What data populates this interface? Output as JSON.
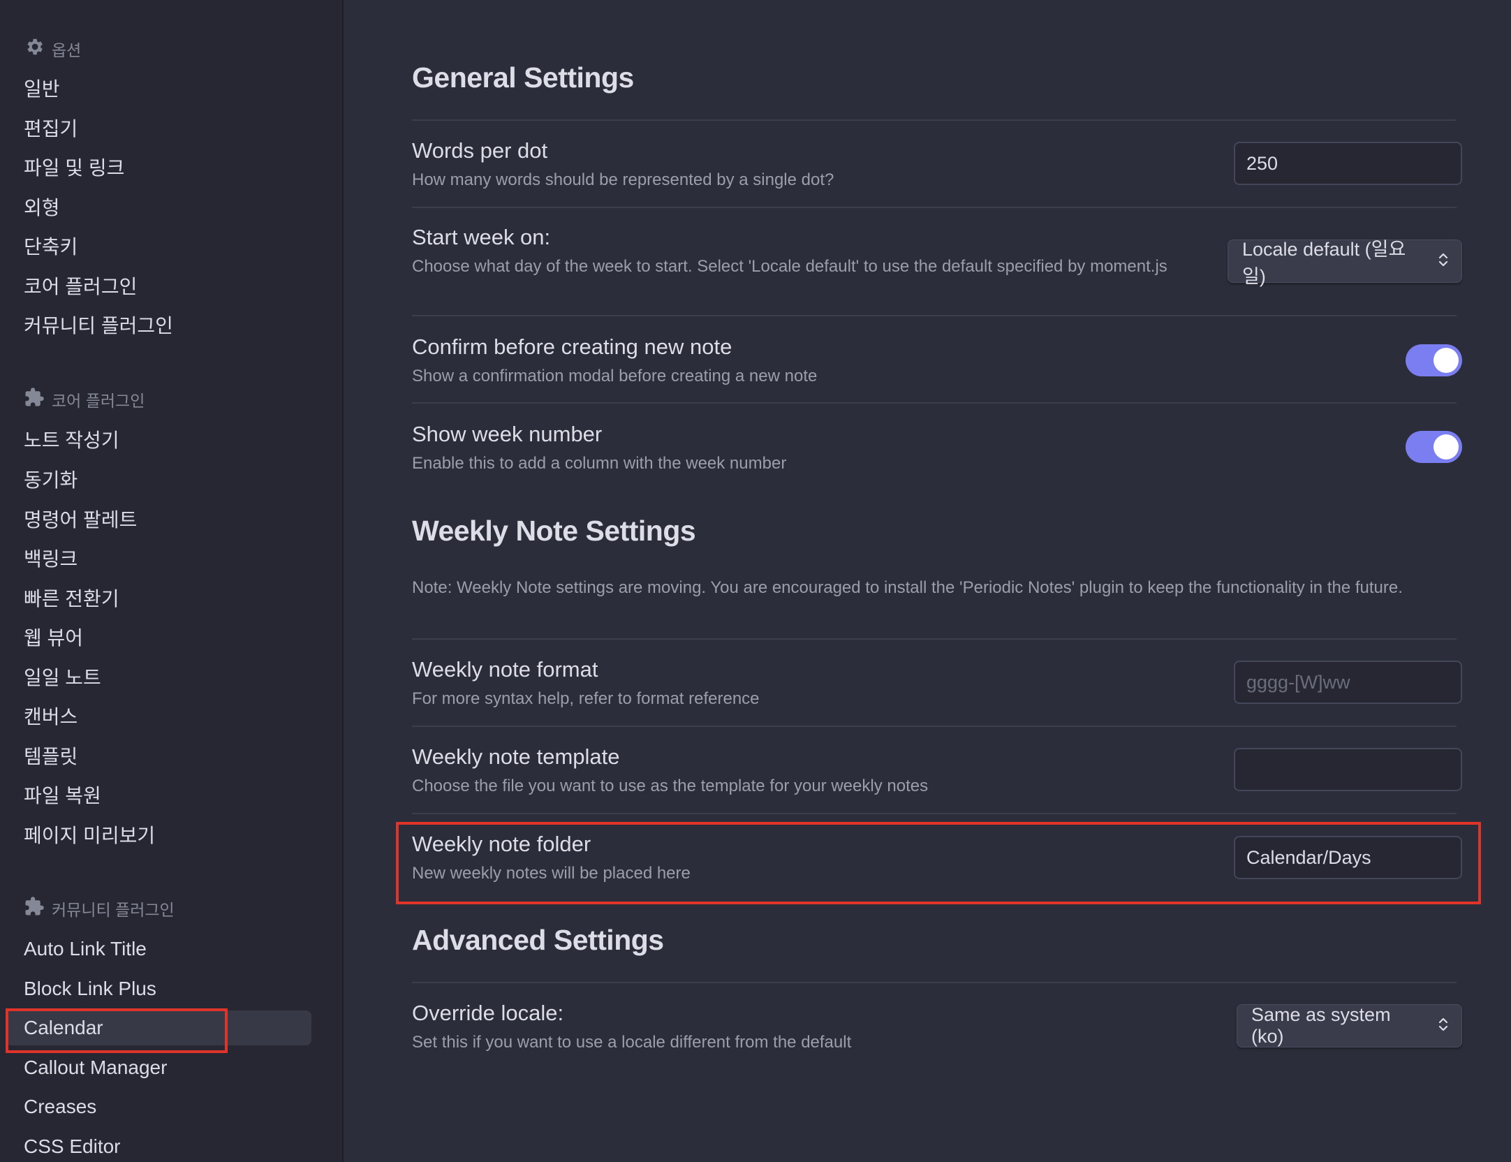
{
  "sidebar": {
    "options_title": "옵션",
    "options_items": [
      "일반",
      "편집기",
      "파일 및 링크",
      "외형",
      "단축키",
      "코어 플러그인",
      "커뮤니티 플러그인"
    ],
    "core_title": "코어 플러그인",
    "core_items": [
      "노트 작성기",
      "동기화",
      "명령어 팔레트",
      "백링크",
      "빠른 전환기",
      "웹 뷰어",
      "일일 노트",
      "캔버스",
      "템플릿",
      "파일 복원",
      "페이지 미리보기"
    ],
    "community_title": "커뮤니티 플러그인",
    "community_items": [
      "Auto Link Title",
      "Block Link Plus",
      "Calendar",
      "Callout Manager",
      "Creases",
      "CSS Editor"
    ],
    "active_item": "Calendar"
  },
  "general": {
    "heading": "General Settings",
    "words_per_dot": {
      "name": "Words per dot",
      "desc": "How many words should be represented by a single dot?",
      "value": "250"
    },
    "start_week": {
      "name": "Start week on:",
      "desc": "Choose what day of the week to start. Select 'Locale default' to use the default specified by moment.js",
      "value": "Locale default (일요일)"
    },
    "confirm_new": {
      "name": "Confirm before creating new note",
      "desc": "Show a confirmation modal before creating a new note",
      "enabled": true
    },
    "week_number": {
      "name": "Show week number",
      "desc": "Enable this to add a column with the week number",
      "enabled": true
    }
  },
  "weekly": {
    "heading": "Weekly Note Settings",
    "note": "Note: Weekly Note settings are moving. You are encouraged to install the 'Periodic Notes' plugin to keep the functionality in the future.",
    "format": {
      "name": "Weekly note format",
      "desc": "For more syntax help, refer to format reference",
      "value": "",
      "placeholder": "gggg-[W]ww"
    },
    "template": {
      "name": "Weekly note template",
      "desc": "Choose the file you want to use as the template for your weekly notes",
      "value": "",
      "placeholder": ""
    },
    "folder": {
      "name": "Weekly note folder",
      "desc": "New weekly notes will be placed here",
      "value": "Calendar/Days"
    }
  },
  "advanced": {
    "heading": "Advanced Settings",
    "locale": {
      "name": "Override locale:",
      "desc": "Set this if you want to use a locale different from the default",
      "value": "Same as system (ko)"
    }
  },
  "colors": {
    "accent": "#7b7ef0",
    "highlight": "#e0342a",
    "background": "#2c2d3a",
    "sidebar": "#262733"
  },
  "icons": {
    "options": "gear-icon",
    "core": "puzzle-icon",
    "community": "puzzle-icon",
    "dropdown": "chevron-updown-icon"
  }
}
